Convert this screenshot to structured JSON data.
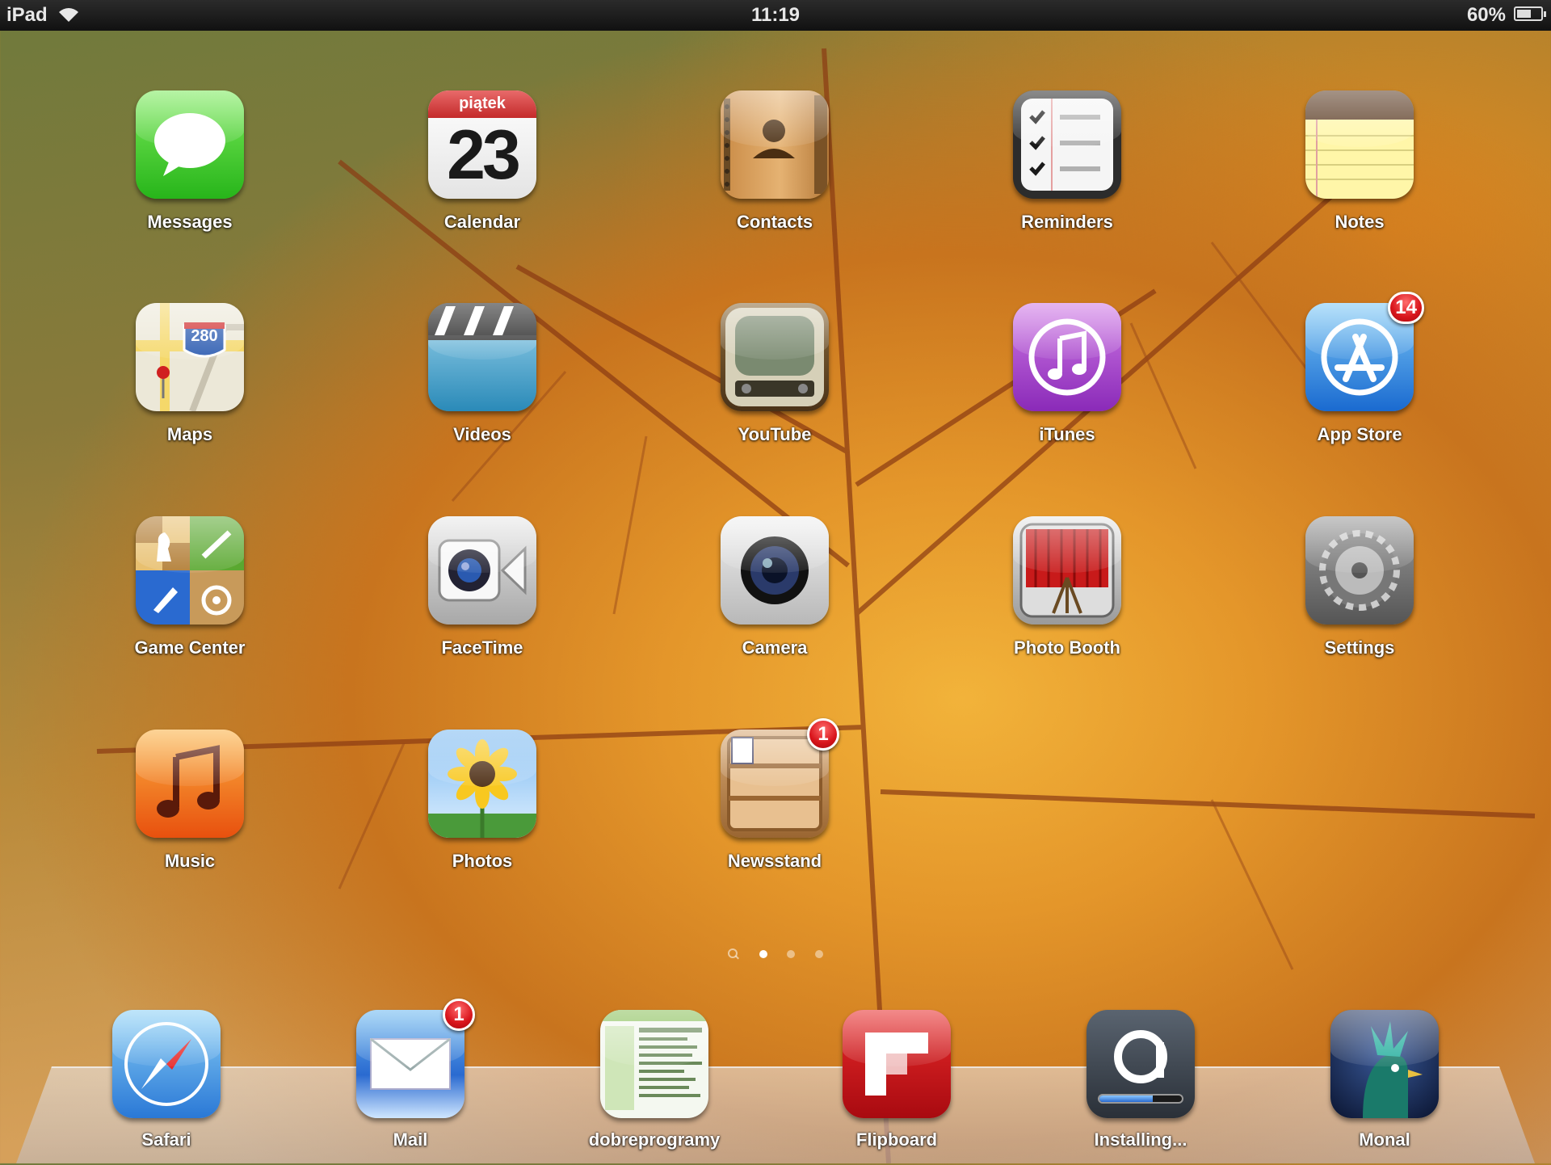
{
  "status_bar": {
    "carrier": "iPad",
    "time": "11:19",
    "battery_percent": "60%",
    "battery_level": 0.6
  },
  "apps": [
    {
      "name": "Messages",
      "icon": "messages-icon"
    },
    {
      "name": "Calendar",
      "icon": "calendar-icon",
      "day_name": "piątek",
      "day_number": "23"
    },
    {
      "name": "Contacts",
      "icon": "contacts-icon"
    },
    {
      "name": "Reminders",
      "icon": "reminders-icon"
    },
    {
      "name": "Notes",
      "icon": "notes-icon"
    },
    {
      "name": "Maps",
      "icon": "maps-icon",
      "highway": "280"
    },
    {
      "name": "Videos",
      "icon": "videos-icon"
    },
    {
      "name": "YouTube",
      "icon": "youtube-icon"
    },
    {
      "name": "iTunes",
      "icon": "itunes-icon"
    },
    {
      "name": "App Store",
      "icon": "app-store-icon",
      "badge": "14"
    },
    {
      "name": "Game Center",
      "icon": "game-center-icon"
    },
    {
      "name": "FaceTime",
      "icon": "facetime-icon"
    },
    {
      "name": "Camera",
      "icon": "camera-icon"
    },
    {
      "name": "Photo Booth",
      "icon": "photo-booth-icon"
    },
    {
      "name": "Settings",
      "icon": "settings-icon"
    },
    {
      "name": "Music",
      "icon": "music-icon"
    },
    {
      "name": "Photos",
      "icon": "photos-icon"
    },
    {
      "name": "Newsstand",
      "icon": "newsstand-icon",
      "badge": "1"
    }
  ],
  "page_indicator": {
    "pages": 3,
    "current": 1,
    "has_search_page": true
  },
  "dock": [
    {
      "name": "Safari",
      "icon": "safari-icon"
    },
    {
      "name": "Mail",
      "icon": "mail-icon",
      "badge": "1"
    },
    {
      "name": "dobreprogramy",
      "icon": "dobreprogramy-icon"
    },
    {
      "name": "Flipboard",
      "icon": "flipboard-icon"
    },
    {
      "name": "Installing...",
      "icon": "installing-icon",
      "progress": 0.65
    },
    {
      "name": "Monal",
      "icon": "monal-icon"
    }
  ]
}
